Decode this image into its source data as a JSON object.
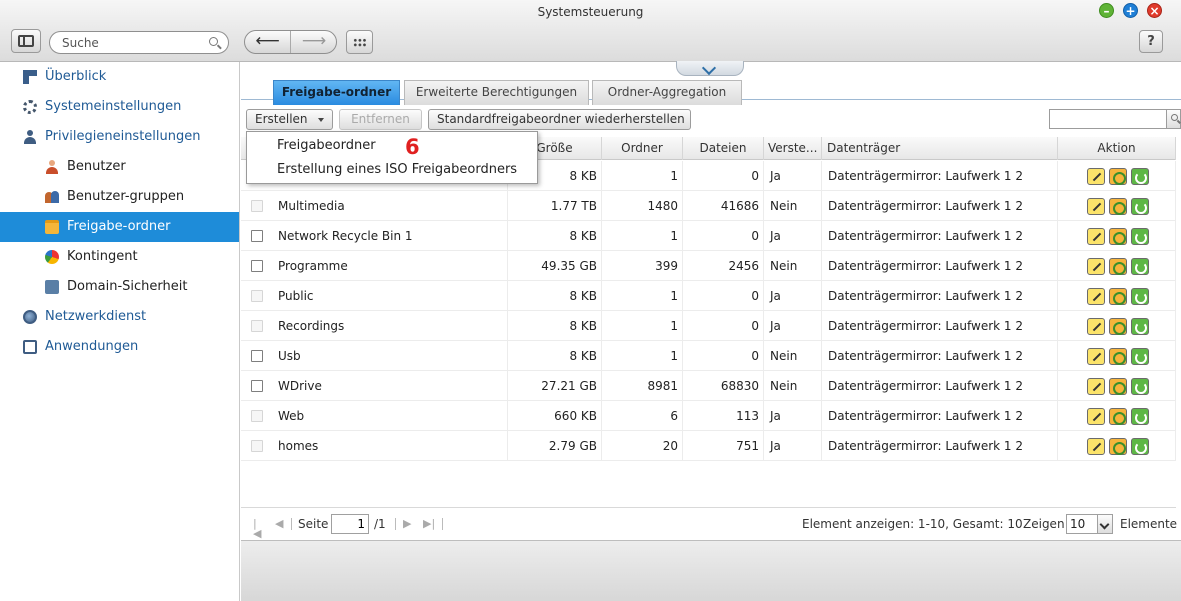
{
  "window": {
    "title": "Systemsteuerung"
  },
  "toolbar": {
    "search_placeholder": "Suche",
    "help_label": "?",
    "back_glyph": "⟵",
    "forward_glyph": "⟶"
  },
  "sidebar": {
    "items": [
      {
        "label": "Überblick",
        "icon": "overview-grid-icon"
      },
      {
        "label": "Systemeinstellungen",
        "icon": "gear-icon"
      },
      {
        "label": "Privilegieneinstellungen",
        "icon": "person-icon"
      },
      {
        "label": "Benutzer",
        "icon": "user-icon"
      },
      {
        "label": "Benutzer-gruppen",
        "icon": "user-group-icon"
      },
      {
        "label": "Freigabe-ordner",
        "icon": "shared-folder-icon"
      },
      {
        "label": "Kontingent",
        "icon": "quota-icon"
      },
      {
        "label": "Domain-Sicherheit",
        "icon": "domain-security-icon"
      },
      {
        "label": "Netzwerkdienst",
        "icon": "globe-icon"
      },
      {
        "label": "Anwendungen",
        "icon": "applications-icon"
      }
    ],
    "active_index": 5
  },
  "tabs": [
    {
      "label": "Freigabe-ordner"
    },
    {
      "label": "Erweiterte Berechtigungen"
    },
    {
      "label": "Ordner-Aggregation"
    }
  ],
  "actions": {
    "create_label": "Erstellen",
    "remove_label": "Entfernen",
    "restore_label": "Standardfreigabeordner wiederherstellen"
  },
  "dropdown": {
    "items": [
      {
        "label": "Freigabeordner"
      },
      {
        "label": "Erstellung eines ISO Freigabeordners"
      }
    ],
    "step_marker": "6"
  },
  "table": {
    "columns": [
      "Größe",
      "Ordner",
      "Dateien",
      "Verste...",
      "Datenträger",
      "Aktion"
    ],
    "rows": [
      {
        "name": "",
        "size": "8 KB",
        "folders": "1",
        "files": "0",
        "hidden": "Ja",
        "volume": "Datenträgermirror: Laufwerk 1 2",
        "checkbox": "hidden"
      },
      {
        "name": "Multimedia",
        "size": "1.77 TB",
        "folders": "1480",
        "files": "41686",
        "hidden": "Nein",
        "volume": "Datenträgermirror: Laufwerk 1 2",
        "checkbox": "disabled"
      },
      {
        "name": "Network Recycle Bin 1",
        "size": "8 KB",
        "folders": "1",
        "files": "0",
        "hidden": "Ja",
        "volume": "Datenträgermirror: Laufwerk 1 2",
        "checkbox": "enabled"
      },
      {
        "name": "Programme",
        "size": "49.35 GB",
        "folders": "399",
        "files": "2456",
        "hidden": "Nein",
        "volume": "Datenträgermirror: Laufwerk 1 2",
        "checkbox": "enabled"
      },
      {
        "name": "Public",
        "size": "8 KB",
        "folders": "1",
        "files": "0",
        "hidden": "Ja",
        "volume": "Datenträgermirror: Laufwerk 1 2",
        "checkbox": "disabled"
      },
      {
        "name": "Recordings",
        "size": "8 KB",
        "folders": "1",
        "files": "0",
        "hidden": "Ja",
        "volume": "Datenträgermirror: Laufwerk 1 2",
        "checkbox": "disabled"
      },
      {
        "name": "Usb",
        "size": "8 KB",
        "folders": "1",
        "files": "0",
        "hidden": "Nein",
        "volume": "Datenträgermirror: Laufwerk 1 2",
        "checkbox": "enabled"
      },
      {
        "name": "WDrive",
        "size": "27.21 GB",
        "folders": "8981",
        "files": "68830",
        "hidden": "Nein",
        "volume": "Datenträgermirror: Laufwerk 1 2",
        "checkbox": "enabled"
      },
      {
        "name": "Web",
        "size": "660 KB",
        "folders": "6",
        "files": "113",
        "hidden": "Ja",
        "volume": "Datenträgermirror: Laufwerk 1 2",
        "checkbox": "disabled"
      },
      {
        "name": "homes",
        "size": "2.79 GB",
        "folders": "20",
        "files": "751",
        "hidden": "Ja",
        "volume": "Datenträgermirror: Laufwerk 1 2",
        "checkbox": "disabled"
      }
    ],
    "row_action_icons": [
      "edit-icon",
      "permission-icon",
      "refresh-icon"
    ]
  },
  "pager": {
    "page_label": "Seite",
    "page_value": "1",
    "page_total": "/1",
    "summary": "Element anzeigen: 1-10, Gesamt: 10",
    "show_label": "Zeigen",
    "per_page": "10",
    "items_label": "Elemente"
  },
  "colors": {
    "active_tab": "#2a8be0",
    "sidebar_active": "#1e8cd9",
    "step_marker": "#e02020"
  }
}
